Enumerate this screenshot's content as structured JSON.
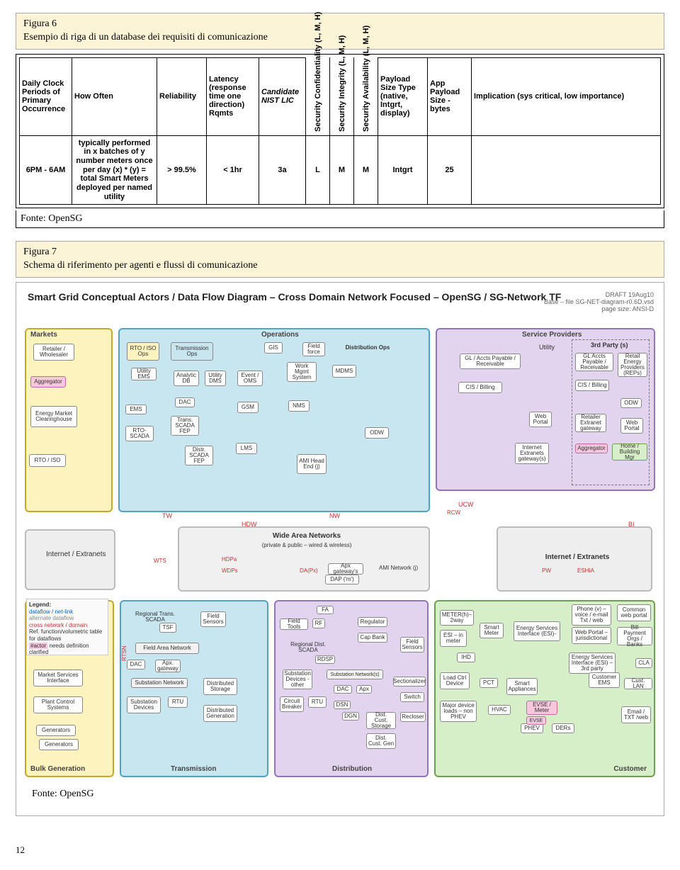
{
  "fig6": {
    "title": "Figura 6",
    "subtitle": "Esempio di riga di un database dei requisiti di comunicazione"
  },
  "table": {
    "headers": {
      "c1": "Daily Clock Periods of Primary Occurrence",
      "c2": "How Often",
      "c3": "Reliability",
      "c4": "Latency (response time one direction) Rqmts",
      "c5": "Candidate NIST LIC",
      "c6": "Security Confidentiality (L, M, H)",
      "c7": "Security Integrity (L, M, H)",
      "c8": "Security Availability (L, M, H)",
      "c9": "Payload Size Type (native, Intgrt, display)",
      "c10": "App Payload Size - bytes",
      "c11": "Implication (sys critical, low importance)"
    },
    "row": {
      "c1": "6PM - 6AM",
      "c2": "typically performed in x batches of y number meters once per day (x) * (y) = total Smart Meters deployed per named utility",
      "c3": "> 99.5%",
      "c4": "< 1hr",
      "c5": "3a",
      "c6": "L",
      "c7": "M",
      "c8": "M",
      "c9": "Intgrt",
      "c10": "25",
      "c11": ""
    }
  },
  "source6": "Fonte: OpenSG",
  "fig7": {
    "title": "Figura 7",
    "subtitle": "Schema di riferimento per agenti e flussi di comunicazione"
  },
  "diagram": {
    "title": "Smart Grid Conceptual Actors / Data Flow Diagram – Cross Domain Network Focused – OpenSG / SG-Network TF",
    "note1": "DRAFT 19Aug10",
    "note2": "Base – file SG-NET-diagram-r0.6D.vsd",
    "note3": "page size: ANSI-D",
    "zones": {
      "markets": "Markets",
      "ops": "Operations",
      "service": "Service Providers",
      "wan_title": "Wide Area Networks",
      "wan_sub": "(private & public – wired & wireless)",
      "internet1": "Internet / Extranets",
      "internet2": "Internet / Extranets",
      "bulk": "Bulk Generation",
      "trans": "Transmission",
      "dist": "Distribution",
      "cust": "Customer"
    },
    "nodes": {
      "retailer": "Retailer / Wholesaler",
      "aggregator": "Aggregator",
      "emc": "Energy Market Clearinghouse",
      "rtoiso": "RTO / ISO",
      "rtoiso_ops": "RTO / ISO Ops",
      "utility_ems": "Utility EMS",
      "ems": "EMS",
      "rto_scada": "RTO-SCADA",
      "trans_ops": "Transmission Ops",
      "analytic_db": "Analytic DB",
      "utility_dms": "Utility DMS",
      "dac1": "DAC",
      "trans_scada_fep": "Trans. SCADA FEP",
      "distr_scada_fep": "Distr. SCADA FEP",
      "gis": "GIS",
      "field_force": "Field force",
      "gsm": "GSM",
      "event_oms": "Event / OMS",
      "lms": "LMS",
      "dist_ops": "Distribution Ops",
      "work_mgmt": "Work Mgmt System",
      "nms": "NMS",
      "mdms": "MDMS",
      "ami_head": "AMI Head End (j)",
      "odw": "ODW",
      "gl_accts": "GL / Accts Payable / Receivable",
      "cis_billing": "CIS / Billing",
      "webportal_sp": "Web Portal",
      "internet_gw": "Internet Extranets gateway(s)",
      "utility_lbl": "Utility",
      "third_party": "3rd Party (s)",
      "gl_tp": "GL Accts Payable / Receivable",
      "cis_tp": "CIS / Billing",
      "retailer_ext": "Retailer Extranet gateway",
      "webportal_tp": "Web Portal",
      "aggregator2": "Aggregator",
      "odw2": "ODW",
      "rep": "Retail Energy Providers (REPs)",
      "home_bldg": "Home / Building Mgr",
      "legend_t": "Legend:",
      "legend1": "dataflow / net-link",
      "legend2": "alternate dataflow",
      "legend3": "cross network / domain",
      "legend4": "Ref. function/volumetric table for dataflows",
      "legend5": "needs definition clarified",
      "actor_tag": "#actor",
      "msi": "Market Services Interface",
      "pcs": "Plant Control Systems",
      "generators": "Generators",
      "generators2": "Generators",
      "rtn": "Regional Trans. SCADA",
      "fan_t": "Field Area Network",
      "sub_net": "Substation Network",
      "sub_dev": "Substation Devices",
      "rtu": "RTU",
      "dac2": "DAC",
      "apx": "Apx. gateway",
      "fld_sens_t": "Field Sensors",
      "dist_stor": "Distributed Storage",
      "dist_gen": "Distributed Generation",
      "tsf": "TSF",
      "rdn": "Regional Dist. SCADA",
      "rdsn": "Substation Network(s)",
      "rdsp": "RDSP",
      "dsn": "DSN",
      "sub_dev_o": "Substation Devices - other",
      "cb_rtu": "Circuit Breaker",
      "rtu2": "RTU",
      "dac3": "DAC",
      "apx2": "Apx",
      "dgn": "DGN",
      "dist_cust_stor": "Dist. Cust. Storage",
      "dist_cust_gen": "Dist. Cust. Gen",
      "ft": "Field Tools",
      "fa": "FA",
      "regulator": "Regulator",
      "capbank": "Cap Bank",
      "sectionalizer": "Sectionalizer",
      "switch": "Switch",
      "recloser": "Recloser",
      "fld_sens_d": "Field Sensors",
      "meter2": "METER(h)– 2way",
      "esi_in": "ESI – in meter",
      "smart_meter": "Smart Meter",
      "iho": "IHD",
      "load_ctrl": "Load Ctrl Device",
      "maj_dev": "Major device loads – non PHEV",
      "pct": "PCT",
      "smart_appl": "Smart Appliances",
      "hvac": "HVAC",
      "esi": "Energy Services Interface (ESI)-",
      "phone": "Phone (v) – voice / e-mail Txt / web",
      "common": "Common web portal",
      "webportal_j": "Web Portal – jurisdictional",
      "billpay": "Bill Payment Orgs / Banks",
      "rcw": "RCW",
      "esi2": "Energy Services Interface (ESI) – 3rd party",
      "cust_ems": "Customer EMS",
      "evse_m": "EVSE / Meter",
      "phev": "PHEV",
      "ders": "DERs",
      "cust_lan": "Cust. LAN",
      "email": "Email / TXT /web",
      "cla": "CLA",
      "evse": "EVSE",
      "dap": "DAP ('m')",
      "ami_net": "AMI Network (j)",
      "apx_gw2": "Apx gateway's",
      "dapx": "DA(Px)",
      "ucw": "UCW",
      "tw": "TW",
      "nw": "NW",
      "hdw": "HDW",
      "hdps": "HDPa",
      "wdps": "WDPs",
      "bi": "BI",
      "pw": "PW",
      "eshia": "ESHIA",
      "rf": "RF",
      "wts": "WTS"
    }
  },
  "source7": "Fonte: OpenSG",
  "pagenum": "12"
}
